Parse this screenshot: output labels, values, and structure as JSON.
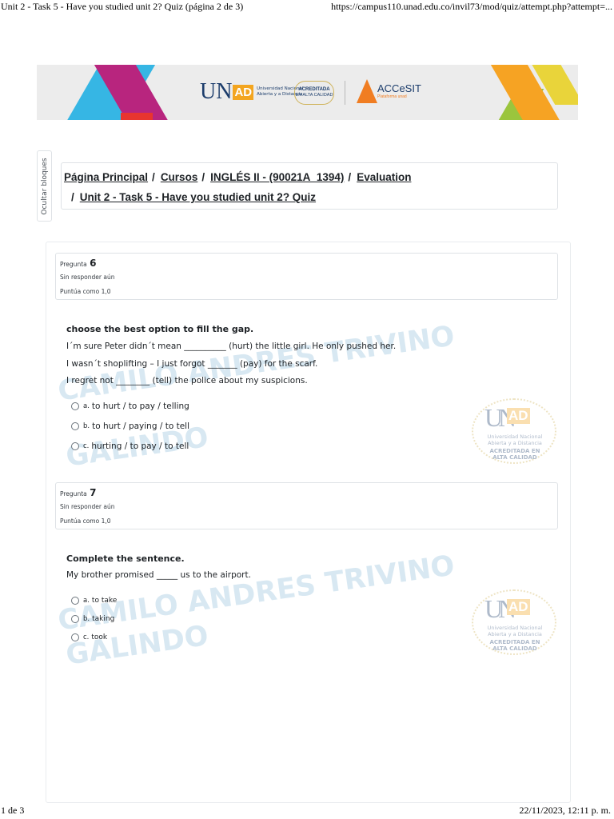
{
  "print_header": {
    "title": "Unit 2 - Task 5 - Have you studied unit 2? Quiz (página 2 de 3)",
    "url": "https://campus110.unad.edu.co/invil73/mod/quiz/attempt.php?attempt=..."
  },
  "print_footer": {
    "page": "1 de 3",
    "datetime": "22/11/2023, 12:11 p. m."
  },
  "banner": {
    "unad_u": "U",
    "unad_n": "N",
    "unad_ad": "AD",
    "unad_sub": "Universidad Nacional Abierta y a Distancia",
    "acreditada": "ACREDITADA",
    "alta_calidad": "EN ALTA CALIDAD",
    "accesit": "ACCeSIT",
    "accesit_sub": "Plataforma unad"
  },
  "side_tab": {
    "label": "Ocultar bloques"
  },
  "breadcrumb": {
    "items": [
      "Página Principal",
      "Cursos",
      "INGLÉS II - (90021A_1394)",
      "Evaluation",
      "Unit 2 - Task 5 - Have you studied unit 2? Quiz"
    ],
    "separator": "/"
  },
  "questions": [
    {
      "label": "Pregunta",
      "number": "6",
      "state": "Sin responder aún",
      "grade": "Puntúa como 1,0",
      "title": "choose the best option to fill the gap.",
      "lines": [
        "I´m sure Peter didn´t mean __________ (hurt) the little girl. He only pushed her.",
        "I wasn´t shoplifting – I just forgot _______ (pay) for the scarf.",
        "I regret not ________ (tell) the police about my suspicions."
      ],
      "options": [
        {
          "letter": "a.",
          "text": "to hurt / to pay / telling"
        },
        {
          "letter": "b.",
          "text": "to hurt / paying / to tell"
        },
        {
          "letter": "c.",
          "text": "hurting / to pay / to tell"
        }
      ]
    },
    {
      "label": "Pregunta",
      "number": "7",
      "state": "Sin responder aún",
      "grade": "Puntúa como 1,0",
      "title": "Complete the sentence.",
      "lines": [
        "My brother promised _____ us to the airport."
      ],
      "options": [
        {
          "letter": "a.",
          "text": "to take"
        },
        {
          "letter": "b.",
          "text": "taking"
        },
        {
          "letter": "c.",
          "text": "took"
        }
      ]
    }
  ],
  "watermark": {
    "line1": "CAMILO ANDRES TRIVINO",
    "line2": "GALINDO"
  },
  "seal": {
    "u": "U",
    "n": "N",
    "ad": "AD",
    "line1": "Universidad Nacional Abierta y a Distancia",
    "line2": "ACREDITADA EN ALTA CALIDAD"
  }
}
